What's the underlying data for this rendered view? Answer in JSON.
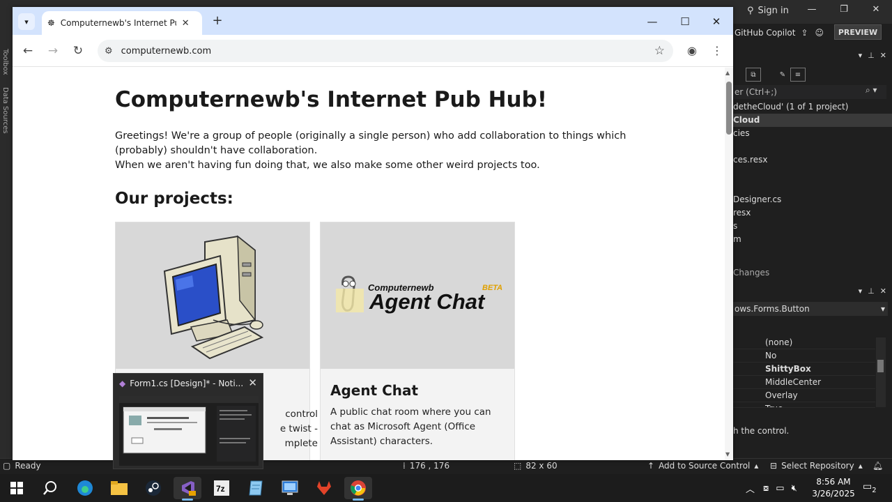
{
  "vs": {
    "sign_in": "Sign in",
    "copilot": "GitHub Copilot",
    "preview_btn": "PREVIEW",
    "search_placeholder": "er (Ctrl+;)",
    "left_tab_1": "Toolbox",
    "left_tab_2": "Data Sources",
    "tree": [
      {
        "label": "detheCloud' (1 of 1 project)",
        "selected": false
      },
      {
        "label": "Cloud",
        "selected": true
      },
      {
        "label": "cies",
        "selected": false
      },
      {
        "label": "ces.resx",
        "selected": false
      },
      {
        "label": "Designer.cs",
        "selected": false
      },
      {
        "label": "resx",
        "selected": false
      },
      {
        "label": "s",
        "selected": false
      },
      {
        "label": "m",
        "selected": false
      }
    ],
    "changes_tab": "Changes",
    "props_object": "ows.Forms.Button",
    "props_rows": [
      "(none)",
      "No",
      "ShittyBox",
      "MiddleCenter",
      "Overlay",
      "True"
    ],
    "props_desc": "h the control."
  },
  "status": {
    "ready": "Ready",
    "position": "176 , 176",
    "size": "82 x 60",
    "source_control": "Add to Source Control",
    "select_repo": "Select Repository"
  },
  "browser": {
    "tab_title": "Computernewb's Internet Pub Hub!",
    "url": "computernewb.com"
  },
  "page": {
    "heading": "Computernewb's Internet Pub Hub!",
    "intro_line1": "Greetings! We're a group of people (originally a single person) who add collaboration to things which (probably) shouldn't have collaboration.",
    "intro_line2": "When we aren't having fun doing that, we also make some other weird projects too.",
    "projects_heading": "Our projects:",
    "cards": [
      {
        "title": "",
        "desc_fragments": [
          "control",
          "e twist -",
          "mplete"
        ]
      },
      {
        "title": "Agent Chat",
        "desc": "A public chat room where you can chat as Microsoft Agent (Office Assistant) characters.",
        "logo_small": "Computernewb",
        "logo_big": "Agent Chat",
        "logo_beta": "BETA"
      }
    ]
  },
  "thumbnail": {
    "title": "Form1.cs [Design]* - Noti..."
  },
  "taskbar": {
    "time": "8:56 AM",
    "date": "3/26/2025",
    "notif_count": "2",
    "app_7z": "7z"
  }
}
